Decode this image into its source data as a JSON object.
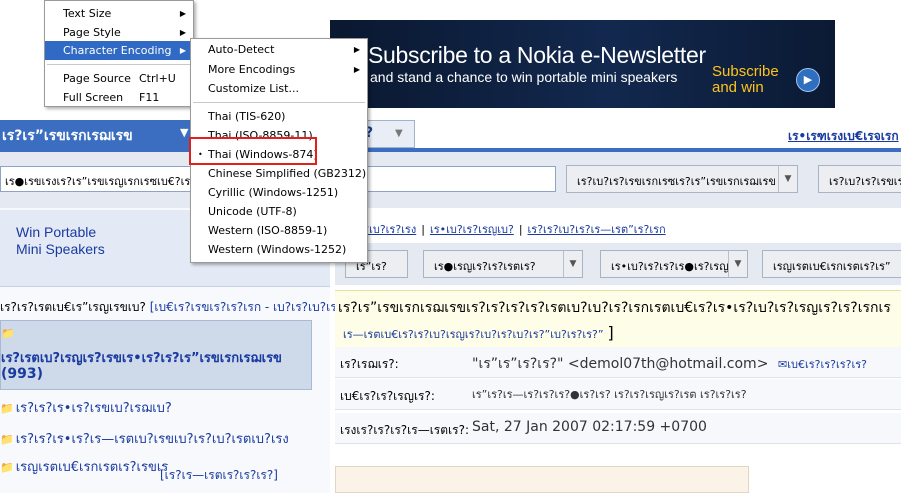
{
  "parent_menu": {
    "items": [
      {
        "label": "Text Size",
        "shortcut": "",
        "submenu": true
      },
      {
        "label": "Page Style",
        "shortcut": "",
        "submenu": true
      },
      {
        "label": "Character Encoding",
        "shortcut": "",
        "submenu": true,
        "highlighted": true
      },
      {
        "label": "Page Source",
        "shortcut": "Ctrl+U",
        "submenu": false
      },
      {
        "label": "Full Screen",
        "shortcut": "F11",
        "submenu": false
      }
    ]
  },
  "encoding_menu": {
    "top_items": [
      {
        "label": "Auto-Detect",
        "submenu": true
      },
      {
        "label": "More Encodings",
        "submenu": true
      },
      {
        "label": "Customize List...",
        "submenu": false
      }
    ],
    "encodings": [
      {
        "label": "Thai (TIS-620)",
        "selected": false
      },
      {
        "label": "Thai (ISO-8859-11)",
        "selected": false
      },
      {
        "label": "Thai (Windows-874)",
        "selected": true
      },
      {
        "label": "Chinese Simplified (GB2312)",
        "selected": false
      },
      {
        "label": "Cyrillic (Windows-1251)",
        "selected": false
      },
      {
        "label": "Unicode (UTF-8)",
        "selected": false
      },
      {
        "label": "Western (ISO-8859-1)",
        "selected": false
      },
      {
        "label": "Western (Windows-1252)",
        "selected": false
      }
    ],
    "bullet": "•"
  },
  "banner": {
    "line1": "Subscribe to a Nokia e-Newsletter",
    "line2": "and stand a chance to win portable mini speakers",
    "cta_line1": "Subscribe",
    "cta_line2": "and win",
    "play_glyph": "▶"
  },
  "header": {
    "title": "เร?เร”เรขเรกเรฌเรข",
    "dropdown_glyph": "▼",
    "tab_q": "?",
    "tab_arrow": "▼",
    "right_link": "เร•เรฑเรงเบ€เรจเรก"
  },
  "search_row": {
    "search_text": "เร●เรขเรงเร?เร”เรขเรญเรกเรซเบ€?เรฌเรข",
    "button1": "เร?เบ?เร?เรขเรกเรซเร?เร”เรขเรกเรฌเรข",
    "button2": "เร?เบ?เร?เรขเรก"
  },
  "promo": {
    "line1": "Win Portable",
    "line2": "Mini Speakers"
  },
  "inbox": {
    "title": "เร?เร?เรตเบ€เร”เรญเรขเบ?",
    "hint": "[เบ€เร?เรขเร?เร?เรก - เบ?เร?เบ?เร?]"
  },
  "folders": {
    "selected_name": "เร?เรตเบ?เรญเร?เรขเร•เร?เร?เร”เรขเรกเรฌเรข",
    "selected_count": "(993)",
    "items": [
      {
        "label": "เร?เร?เร•เร?เรขเบ?เรฌเบ?"
      },
      {
        "label": "เร?เร?เร•เร?เร—เรตเบ?เรขเบ?เร?เบ?เรตเบ?เรง"
      },
      {
        "label": "เรญเรตเบ€เรกเรตเร?เรขเร"
      }
    ],
    "sub_label": "[เร?เร—เรตเร?เร?เร?]"
  },
  "filters": {
    "link1": "เบ?เร?เบ?เร?เรง",
    "link2": "เร•เบ?เร?เรญเบ?",
    "link3": "เร?เร?เบ?เร?เร—เรต”เร?เรก"
  },
  "toolbar": {
    "b1": "เร”เร?",
    "b2": "เร●เรญเร?เร?เรตเร?",
    "b3": "เร•เบ?เร?เร?เร●เร?เรญ",
    "b4": "เรญเรตเบ€เรกเรตเร?เร”"
  },
  "subject": {
    "main": "เร?เร”เรขเรกเรฌเรขเร?เร?เร?เร?เรตเบ?เบ?เร?เรกเรตเบ€เร?เร•เร?เบ?เร?เรญเร?เร?เรกเร",
    "sub": "เร—เรตเบ€เร?เร?เบ?เรญเร?เบ?เร?เบ?เร?”เบ?เร?เร?”",
    "bracket": "]"
  },
  "headers": [
    {
      "key": "เร?เรฌเร?:",
      "value": "\"เร”เร”เร?เร?\" <demol07th@hotmail.com>",
      "note": "เบ€เร?เร?เร?เร?"
    },
    {
      "key": "เบ€เร?เร?เรญเร?:",
      "value": "เร”เร?เร—เร?เร?เร?●เร?เร? เร?เร?เรญเร?เรต เร?เร?เร?",
      "note": ""
    },
    {
      "key": "เรงเร?เร?เร?เร—เรตเร?:",
      "value": "Sat, 27 Jan 2007 02:17:59 +0700",
      "note": ""
    }
  ],
  "icons": {
    "folder": "📁",
    "envelope": "✉",
    "arrow": "▶",
    "dropdown": "▼"
  }
}
